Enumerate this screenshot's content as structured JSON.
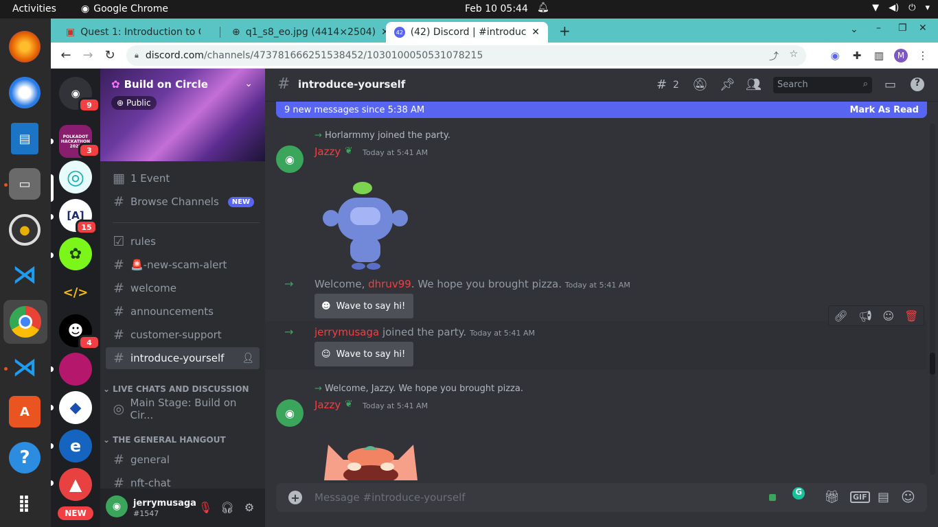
{
  "topbar": {
    "activities": "Activities",
    "app": "Google Chrome",
    "clock": "Feb 10  05:44"
  },
  "tabs": [
    {
      "title": "Quest 1: Introduction to C",
      "close": "✕"
    },
    {
      "title": "q1_s8_eo.jpg (4414×2504)",
      "close": "✕"
    },
    {
      "title": "(42) Discord | #introduce-",
      "close": "✕"
    }
  ],
  "tab_badge": "42",
  "new_tab": "+",
  "omnibox": {
    "host": "discord.com",
    "path": "/channels/473781666251538452/1030100050531078215"
  },
  "profile_initial": "M",
  "servers": {
    "home_badge": "9",
    "items": [
      {
        "label": "POLKADOT HACKATHON 2022",
        "badge": "3"
      },
      {
        "label": "◎",
        "badge": ""
      },
      {
        "label": "[A]",
        "badge": "15"
      },
      {
        "label": "✿",
        "badge": ""
      },
      {
        "label": "</>",
        "badge": ""
      },
      {
        "label": "☻",
        "badge": "4"
      },
      {
        "label": "",
        "badge": ""
      },
      {
        "label": "◆",
        "badge": ""
      },
      {
        "label": "e",
        "badge": ""
      },
      {
        "label": "▲",
        "badge": ""
      }
    ],
    "new_label": "NEW"
  },
  "guild": {
    "name": "Build on Circle",
    "visibility": "Public"
  },
  "channels": {
    "event": "1 Event",
    "browse": "Browse Channels",
    "browse_tag": "NEW",
    "list": [
      "rules",
      "🚨-new-scam-alert",
      "welcome",
      "announcements",
      "customer-support",
      "introduce-yourself"
    ],
    "cat1": "LIVE CHATS AND DISCUSSION",
    "stage": "Main Stage: Build on Cir...",
    "cat2": "THE GENERAL HANGOUT",
    "list2": [
      "general",
      "nft-chat"
    ]
  },
  "user": {
    "name": "jerrymusaga",
    "tag": "#1547"
  },
  "header": {
    "channel": "introduce-yourself",
    "threads": "2",
    "search": "Search"
  },
  "banner": {
    "text": "9 new messages since 5:38 AM",
    "action": "Mark As Read"
  },
  "messages": {
    "m1_reply": "Horlarmmy joined the party.",
    "m1_author": "Jazzy",
    "m1_time": "Today at 5:41 AM",
    "j1_prefix": "Welcome, ",
    "j1_name": "dhruv99",
    "j1_suffix": ". We hope you brought pizza.",
    "j1_time": "Today at 5:41 AM",
    "wave": "Wave to say hi!",
    "j2_name": "jerrymusaga",
    "j2_suffix": " joined the party.",
    "j2_time": "Today at 5:41 AM",
    "m2_reply": "Welcome, Jazzy. We hope you brought pizza.",
    "m2_author": "Jazzy",
    "m2_time": "Today at 5:41 AM"
  },
  "composer": {
    "placeholder": "Message #introduce-yourself",
    "gif": "GIF"
  },
  "colors": {
    "blurple": "#5865f2",
    "red": "#f23f43",
    "green": "#3ba55c"
  }
}
